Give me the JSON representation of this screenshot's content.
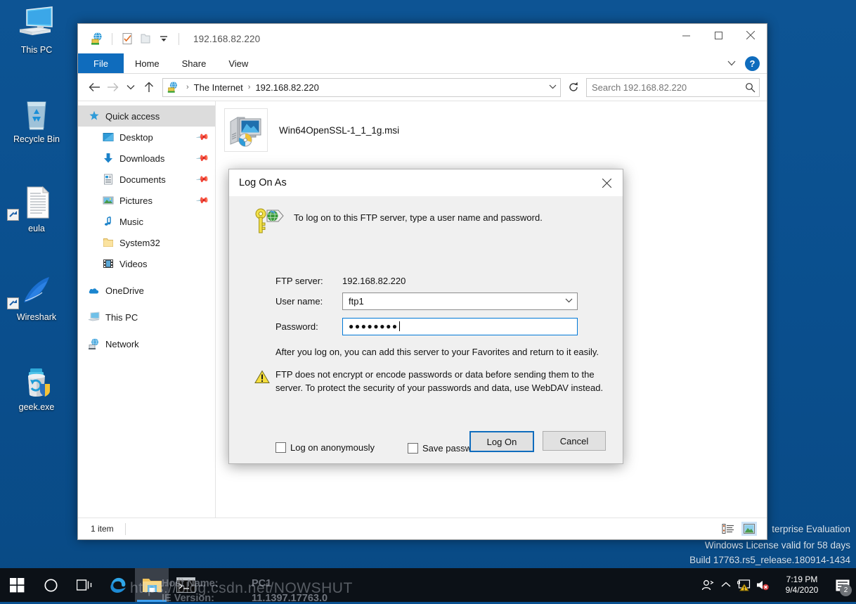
{
  "desktop": {
    "icons": [
      {
        "label": "This PC",
        "icon": "this-pc-icon",
        "shortcut": false
      },
      {
        "label": "Recycle Bin",
        "icon": "recycle-bin-icon",
        "shortcut": false
      },
      {
        "label": "eula",
        "icon": "text-document-icon",
        "shortcut": true
      },
      {
        "label": "Wireshark",
        "icon": "wireshark-icon",
        "shortcut": true
      },
      {
        "label": "geek.exe",
        "icon": "geek-uninstaller-icon",
        "shortcut": false
      }
    ]
  },
  "explorer": {
    "title": "192.168.82.220",
    "quick_access_toolbar": [
      {
        "name": "ftp-site-icon"
      },
      {
        "name": "properties-icon"
      },
      {
        "name": "new-folder-icon"
      },
      {
        "name": "customize-caret-icon"
      }
    ],
    "window_controls": {
      "minimize": "minimize-icon",
      "maximize": "maximize-icon",
      "close": "close-icon"
    },
    "ribbon": {
      "tabs": [
        "File",
        "Home",
        "Share",
        "View"
      ],
      "active_tab": "File",
      "expand_label": "chevron-down-icon",
      "help_label": "?"
    },
    "address": {
      "back": "back-arrow-icon",
      "forward": "forward-arrow-icon",
      "recent": "recent-locations-icon",
      "up": "up-arrow-icon",
      "breadcrumbs": [
        "The Internet",
        "192.168.82.220"
      ],
      "dropdown": "chevron-down-icon",
      "refresh": "refresh-icon"
    },
    "search": {
      "placeholder": "Search 192.168.82.220",
      "value": "",
      "icon": "search-icon"
    },
    "nav_pane": [
      {
        "label": "Quick access",
        "icon": "quick-access-star-icon",
        "indent": 0,
        "selected": true,
        "pinned": false
      },
      {
        "label": "Desktop",
        "icon": "desktop-icon",
        "indent": 1,
        "selected": false,
        "pinned": true
      },
      {
        "label": "Downloads",
        "icon": "downloads-icon",
        "indent": 1,
        "selected": false,
        "pinned": true
      },
      {
        "label": "Documents",
        "icon": "documents-icon",
        "indent": 1,
        "selected": false,
        "pinned": true
      },
      {
        "label": "Pictures",
        "icon": "pictures-icon",
        "indent": 1,
        "selected": false,
        "pinned": true
      },
      {
        "label": "Music",
        "icon": "music-icon",
        "indent": 1,
        "selected": false,
        "pinned": false
      },
      {
        "label": "System32",
        "icon": "folder-icon",
        "indent": 1,
        "selected": false,
        "pinned": false
      },
      {
        "label": "Videos",
        "icon": "videos-icon",
        "indent": 1,
        "selected": false,
        "pinned": false
      },
      {
        "label": "OneDrive",
        "icon": "onedrive-cloud-icon",
        "indent": 0,
        "selected": false,
        "pinned": false
      },
      {
        "label": "This PC",
        "icon": "this-pc-icon",
        "indent": 0,
        "selected": false,
        "pinned": false
      },
      {
        "label": "Network",
        "icon": "network-globe-icon",
        "indent": 0,
        "selected": false,
        "pinned": false
      }
    ],
    "files": [
      {
        "name": "Win64OpenSSL-1_1_1g.msi",
        "icon": "msi-installer-icon"
      }
    ],
    "status": {
      "item_count": "1 item",
      "view_details": "details-view-icon",
      "view_large": "large-icons-view-icon"
    }
  },
  "dialog": {
    "title": "Log On As",
    "close_icon": "close-icon",
    "key_icon": "key-and-globe-icon",
    "intro": "To log on to this FTP server, type a user name and password.",
    "server_label": "FTP server:",
    "server_value": "192.168.82.220",
    "username_label": "User name:",
    "username_value": "ftp1",
    "username_caret": "chevron-down-icon",
    "password_label": "Password:",
    "password_value": "●●●●●●●●",
    "note": "After you log on, you can add this server to your Favorites and return to it easily.",
    "warning_icon": "warning-triangle-icon",
    "warning": "FTP does not encrypt or encode passwords or data before sending them to the server.  To protect the security of your passwords and data, use WebDAV instead.",
    "anonymous_label": "Log on anonymously",
    "anonymous_checked": false,
    "save_password_label": "Save password",
    "save_password_checked": false,
    "logon_button": "Log On",
    "cancel_button": "Cancel"
  },
  "watermarks": {
    "eval_line1": "terprise Evaluation",
    "eval_line2": "Windows License valid for 58 days",
    "eval_line3": "Build 17763.rs5_release.180914-1434",
    "blog_url": "https://blog.csdn.net/NOWSHUT",
    "taskbar_hostname_label": "Host Name:",
    "taskbar_hostname_value": "PC1",
    "taskbar_ieversion_label": "IE Version:",
    "taskbar_ieversion_value": "11.1397.17763.0"
  },
  "taskbar": {
    "start": "windows-start-icon",
    "items": [
      {
        "name": "cortana-search-icon"
      },
      {
        "name": "task-view-icon"
      },
      {
        "name": "edge-browser-icon"
      },
      {
        "name": "file-explorer-icon"
      },
      {
        "name": "command-prompt-icon"
      }
    ],
    "tray": [
      {
        "name": "people-icon"
      },
      {
        "name": "show-hidden-icons-icon"
      },
      {
        "name": "network-warning-icon"
      },
      {
        "name": "volume-muted-icon"
      }
    ],
    "clock_time": "7:19 PM",
    "clock_date": "9/4/2020",
    "action_center": "action-center-icon",
    "notification_count": "2"
  },
  "colors": {
    "desktop_blue": "#0a5191",
    "accent_blue": "#0f6cbd",
    "taskbar": "#0c1117",
    "selection": "#dcdcdc"
  }
}
